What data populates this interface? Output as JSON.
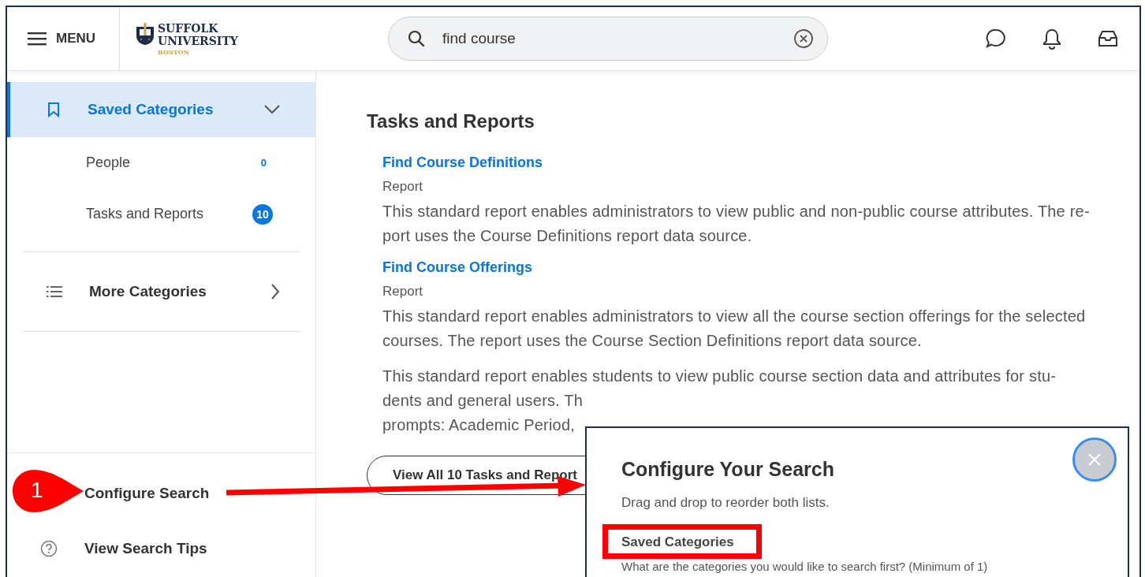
{
  "header": {
    "menu_label": "MENU",
    "logo": {
      "line1": "SUFFOLK",
      "line2": "UNIVERSITY",
      "line3": "BOSTON"
    },
    "search": {
      "value": "find course"
    }
  },
  "sidebar": {
    "sections": [
      {
        "label": "Saved Categories",
        "kind": "bookmark",
        "expanded": true,
        "selected": true,
        "children": [
          {
            "label": "People",
            "count": "0",
            "kind": "plain"
          },
          {
            "label": "Tasks and Reports",
            "count": "10",
            "kind": "badge"
          }
        ]
      },
      {
        "label": "More Categories",
        "kind": "list",
        "expanded": false,
        "selected": false
      }
    ],
    "footer": [
      {
        "label": "Configure Search",
        "kind": "plain"
      },
      {
        "label": "View Search Tips",
        "kind": "help"
      }
    ]
  },
  "results": {
    "heading": "Tasks and Reports",
    "items": [
      {
        "title": "Find Course Definitions",
        "type": "Report",
        "description": "This standard report enables administrators to view public and non-public course attributes. The re-port uses the Course Definitions report data source."
      },
      {
        "title": "Find Course Offerings",
        "type": "Report",
        "description": "This standard report enables administrators to view all the course section offerings for the selected courses. The report uses the Course Section Definitions report data source."
      }
    ],
    "partial_lines": [
      "This standard report enables students to view public course section data and attributes for stu-",
      "dents and general users. Th",
      "prompts: Academic Period,"
    ],
    "view_all_button": "View All 10 Tasks and Report"
  },
  "modal": {
    "title": "Configure Your Search",
    "subtitle": "Drag and drop to reorder both lists.",
    "section_label": "Saved Categories",
    "prompt": "What are the categories you would like to search first? (Minimum of 1)"
  },
  "annotation": {
    "step": "1"
  }
}
